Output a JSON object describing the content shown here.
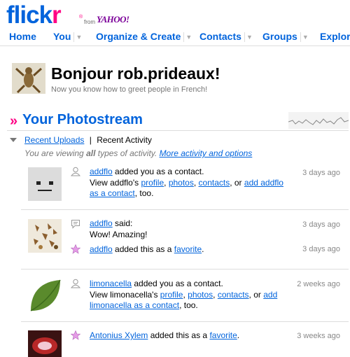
{
  "brand": {
    "name_a": "flick",
    "name_b": "r",
    "registered": "®",
    "from": "from",
    "partner": "YAHOO!"
  },
  "nav": {
    "items": [
      {
        "label": "Home"
      },
      {
        "label": "You"
      },
      {
        "label": "Organize & Create"
      },
      {
        "label": "Contacts"
      },
      {
        "label": "Groups"
      },
      {
        "label": "Explore"
      }
    ]
  },
  "greeting": {
    "title": "Bonjour rob.prideaux!",
    "subtitle": "Now you know how to greet people in French!"
  },
  "photostream": {
    "arrow": "»",
    "title": "Your Photostream"
  },
  "activity": {
    "tab_uploads": "Recent Uploads",
    "separator": "|",
    "tab_activity": "Recent Activity",
    "viewing_prefix": "You are viewing ",
    "viewing_bold": "all",
    "viewing_suffix": " types of activity. ",
    "options_link": "More activity and options"
  },
  "rows": [
    {
      "user": "addflo",
      "action": " added you as a contact.",
      "view_prefix": "View addflo's ",
      "profile": "profile",
      "photos": "photos",
      "contacts": "contacts",
      "add_link": "add addflo as a contact",
      "suffix": ", too.",
      "ago": "3 days ago"
    },
    {
      "user": "addflo",
      "said": " said:",
      "comment": "Wow! Amazing!",
      "ago": "3 days ago",
      "fav_user": "addflo",
      "fav_action": " added this as a ",
      "fav_link": "favorite",
      "fav_end": ".",
      "fav_ago": "3 days ago"
    },
    {
      "user": "limonacella",
      "action": " added you as a contact.",
      "view_prefix": "View limonacella's ",
      "profile": "profile",
      "photos": "photos",
      "contacts": "contacts",
      "add_link": "add limonacella as a contact",
      "suffix": ", too.",
      "ago": "2 weeks ago"
    },
    {
      "user": "Antonius Xylem",
      "fav_action": " added this as a ",
      "fav_link": "favorite",
      "fav_end": ".",
      "ago": "3 weeks ago"
    }
  ],
  "colors": {
    "accent": "#0063dc",
    "pink": "#ff0084",
    "muted": "#777777"
  }
}
